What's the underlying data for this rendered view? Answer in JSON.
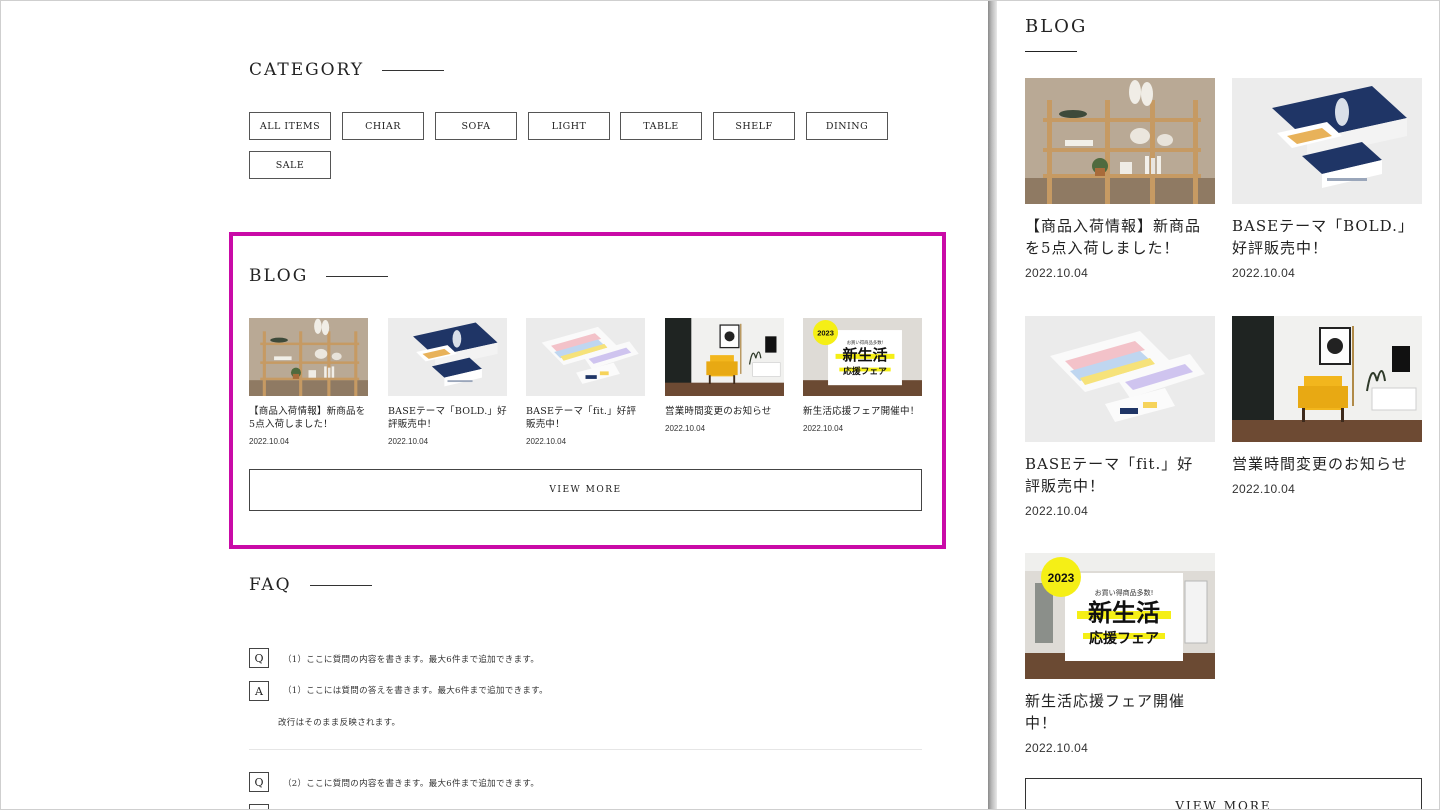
{
  "category": {
    "title": "CATEGORY",
    "items": [
      "ALL ITEMS",
      "CHIAR",
      "SOFA",
      "LIGHT",
      "TABLE",
      "SHELF",
      "DINING",
      "SALE"
    ]
  },
  "blog": {
    "title": "BLOG",
    "posts": [
      {
        "title": "【商品入荷情報】新商品を5点入荷しました！",
        "date": "2022.10.04",
        "image": "shelf"
      },
      {
        "title": "BASEテーマ「BOLD.」好評販売中！",
        "date": "2022.10.04",
        "image": "bold-mockup"
      },
      {
        "title": "BASEテーマ「fit.」好評販売中！",
        "date": "2022.10.04",
        "image": "fit-mockup"
      },
      {
        "title": "営業時間変更のお知らせ",
        "date": "2022.10.04",
        "image": "yellow-chair"
      },
      {
        "title": "新生活応援フェア開催中！",
        "date": "2022.10.04",
        "image": "fair-banner"
      }
    ],
    "view_more": "VIEW MORE",
    "banner": {
      "year": "2023",
      "tag": "お買い得商品多数!",
      "line1": "新生活",
      "line2": "応援フェア"
    }
  },
  "faq": {
    "title": "FAQ",
    "q_mark": "Q",
    "a_mark": "A",
    "items": [
      {
        "q": "（1）ここに質問の内容を書きます。最大6件まで追加できます。",
        "a": "（1）ここには質問の答えを書きます。最大6件まで追加できます。",
        "a2": "改行はそのまま反映されます。"
      },
      {
        "q": "（2）ここに質問の内容を書きます。最大6件まで追加できます。"
      }
    ]
  },
  "right_panel": {
    "title": "BLOG",
    "posts": [
      {
        "title_l1": "【商品入荷情報】新商品",
        "title_l2": "を5点入荷しました！",
        "date": "2022.10.04"
      },
      {
        "title_l1": "BASEテーマ「BOLD.」",
        "title_l2": "好評販売中！",
        "date": "2022.10.04"
      },
      {
        "title_l1": "BASEテーマ「fit.」好",
        "title_l2": "評販売中！",
        "date": "2022.10.04"
      },
      {
        "title_l1": "営業時間変更のお知らせ",
        "title_l2": "",
        "date": "2022.10.04"
      },
      {
        "title_l1": "新生活応援フェア開催",
        "title_l2": "中！",
        "date": "2022.10.04"
      }
    ],
    "view_more": "VIEW MORE"
  },
  "colors": {
    "highlight": "#c90aa7",
    "banner_yellow": "#f5ef16",
    "bold_navy": "#1f3566"
  }
}
